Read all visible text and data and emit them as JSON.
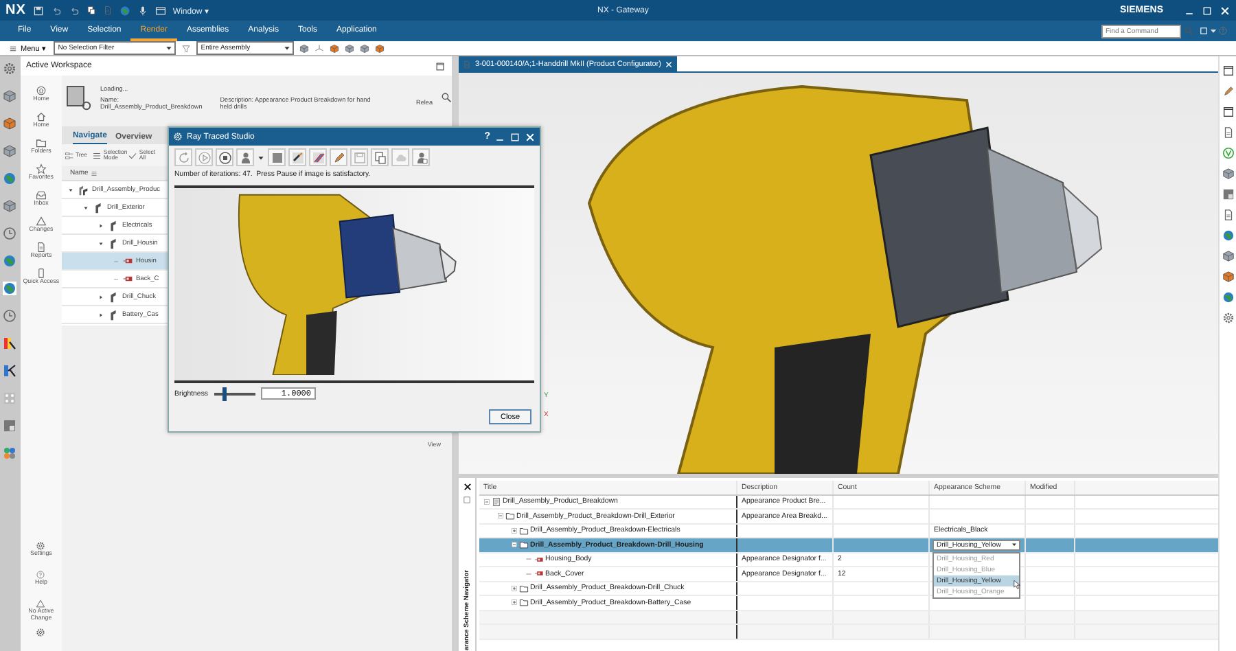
{
  "title_bar": {
    "logo": "NX",
    "window_menu": "Window ▾",
    "title": "NX - Gateway",
    "brand": "SIEMENS"
  },
  "ribbon_tabs": [
    {
      "label": "File",
      "selected": false
    },
    {
      "label": "View",
      "selected": false
    },
    {
      "label": "Selection",
      "selected": false
    },
    {
      "label": "Render",
      "selected": true
    },
    {
      "label": "Assemblies",
      "selected": false
    },
    {
      "label": "Analysis",
      "selected": false
    },
    {
      "label": "Tools",
      "selected": false
    },
    {
      "label": "Application",
      "selected": false
    }
  ],
  "command_search": {
    "placeholder": "Find a Command"
  },
  "toolbar": {
    "menu": "Menu ▾",
    "selection_filter": "No Selection Filter",
    "scope": "Entire Assembly"
  },
  "workspace": {
    "title": "Active Workspace",
    "nav": [
      {
        "label": "Home"
      },
      {
        "label": "Home"
      },
      {
        "label": "Folders"
      },
      {
        "label": "Favorites"
      },
      {
        "label": "Inbox"
      },
      {
        "label": "Changes"
      },
      {
        "label": "Reports"
      },
      {
        "label": "Quick Access"
      }
    ],
    "nav_bottom": [
      {
        "label": "Settings"
      },
      {
        "label": "Help"
      },
      {
        "label": "No Active Change"
      }
    ],
    "loading": "Loading...",
    "name": "Name: Drill_Assembly_Product_Breakdown",
    "description": "Description: Appearance Product Breakdown for hand held drills",
    "release": "Relea",
    "tabs": [
      {
        "label": "Navigate",
        "selected": true
      },
      {
        "label": "Overview",
        "selected": false
      }
    ],
    "tools": [
      "Tree",
      "Selection Mode",
      "Select All"
    ],
    "column": "Name",
    "tree": [
      {
        "label": "Drill_Assembly_Produc",
        "selected": false,
        "expanded": true,
        "children": [
          {
            "label": "Drill_Exterior",
            "selected": false,
            "expanded": true,
            "children": [
              {
                "label": "Electricals",
                "selected": false,
                "expanded": false
              },
              {
                "label": "Drill_Housin",
                "selected": false,
                "expanded": true,
                "children": [
                  {
                    "label": "Housin",
                    "selected": true
                  },
                  {
                    "label": "Back_C",
                    "selected": false
                  }
                ]
              },
              {
                "label": "Drill_Chuck",
                "selected": false,
                "expanded": false
              },
              {
                "label": "Battery_Cas",
                "selected": false,
                "expanded": false
              }
            ]
          }
        ]
      }
    ],
    "view_label": "View"
  },
  "graphics": {
    "tab": "3-001-000140/A;1-Handdrill MkII (Product Configurator)",
    "triad": [
      "Y",
      "X"
    ]
  },
  "dialog": {
    "title": "Ray Traced Studio",
    "help_glyph": "?",
    "status": "Number of iterations: 47.  Press Pause if image is satisfactory.",
    "brightness": {
      "label": "Brightness",
      "level": 0.25,
      "value": "1.0000"
    },
    "close_button": "Close"
  },
  "navigator": {
    "label": "arance Scheme Navigator",
    "columns": [
      "Title",
      "Description",
      "Count",
      "Appearance Scheme",
      "Modified"
    ],
    "rows": [
      {
        "title": "Drill_Assembly_Product_Breakdown",
        "kind": "assembly",
        "expanded": true,
        "selected": false,
        "description": "Appearance Product Bre...",
        "children": [
          {
            "title": "Drill_Assembly_Product_Breakdown-Drill_Exterior",
            "kind": "folder",
            "expanded": true,
            "selected": false,
            "description": "Appearance Area Breakd...",
            "children": [
              {
                "title": "Drill_Assembly_Product_Breakdown-Electricals",
                "kind": "folder",
                "expanded": false,
                "selected": false,
                "scheme": "Electricals_Black"
              },
              {
                "title": "Drill_Assembly_Product_Breakdown-Drill_Housing",
                "kind": "folder",
                "expanded": true,
                "selected": true,
                "scheme_dropdown": {
                  "value": "Drill_Housing_Yellow",
                  "options": [
                    {
                      "label": "Drill_Housing_Red",
                      "selected": false
                    },
                    {
                      "label": "Drill_Housing_Blue",
                      "selected": false
                    },
                    {
                      "label": "Drill_Housing_Yellow",
                      "selected": true
                    },
                    {
                      "label": "Drill_Housing_Orange",
                      "selected": false
                    }
                  ]
                },
                "children": [
                  {
                    "title": "Housing_Body",
                    "kind": "designator",
                    "selected": false,
                    "description": "Appearance Designator f...",
                    "count": "2"
                  },
                  {
                    "title": "Back_Cover",
                    "kind": "designator",
                    "selected": false,
                    "description": "Appearance Designator f...",
                    "count": "12"
                  }
                ]
              },
              {
                "title": "Drill_Assembly_Product_Breakdown-Drill_Chuck",
                "kind": "folder",
                "expanded": false,
                "selected": false
              },
              {
                "title": "Drill_Assembly_Product_Breakdown-Battery_Case",
                "kind": "folder",
                "expanded": false,
                "selected": false
              }
            ]
          }
        ]
      }
    ]
  }
}
